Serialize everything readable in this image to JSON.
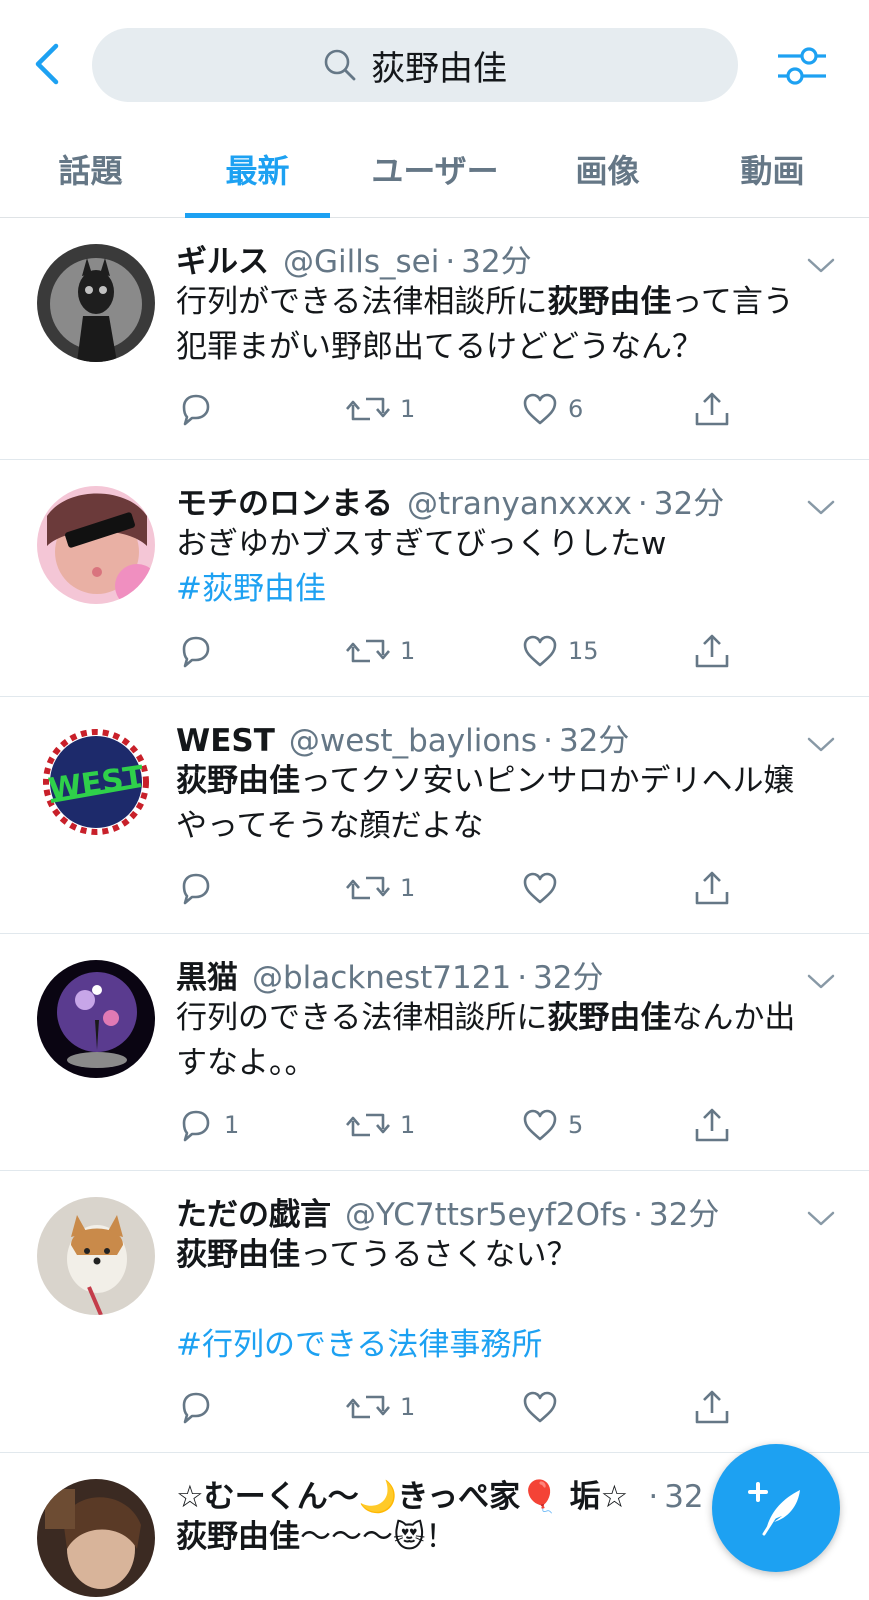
{
  "header": {
    "search_value": "荻野由佳"
  },
  "tabs": [
    {
      "label": "話題"
    },
    {
      "label": "最新"
    },
    {
      "label": "ユーザー"
    },
    {
      "label": "画像"
    },
    {
      "label": "動画"
    }
  ],
  "active_tab": "最新",
  "accent_color": "#1da1f2",
  "tweets": [
    {
      "name": "ギルス",
      "handle": "@Gills_sei",
      "time": "32分",
      "text_before": "行列ができる法律相談所に",
      "text_bold": "荻野由佳",
      "text_after": "って言う犯罪まがい野郎出てるけどどうなん？",
      "reply_count": "",
      "retweet_count": "1",
      "like_count": "6"
    },
    {
      "name": "モチのロンまる",
      "handle": "@tranyanxxxx",
      "time": "32分",
      "text": "おぎゆかブスすぎてびっくりしたw",
      "hashtag": "#荻野由佳",
      "reply_count": "",
      "retweet_count": "1",
      "like_count": "15"
    },
    {
      "name": "WEST",
      "handle": "@west_baylions",
      "time": "32分",
      "text_bold": "荻野由佳",
      "text_after": "ってクソ安いピンサロかデリヘル嬢やってそうな顔だよな",
      "reply_count": "",
      "retweet_count": "1",
      "like_count": ""
    },
    {
      "name": "黒猫",
      "handle": "@blacknest7121",
      "time": "32分",
      "text_before": "行列のできる法律相談所に",
      "text_bold": "荻野由佳",
      "text_after": "なんか出すなよ。。",
      "reply_count": "1",
      "retweet_count": "1",
      "like_count": "5"
    },
    {
      "name": "ただの戯言",
      "handle": "@YC7ttsr5eyf2Ofs",
      "time": "32分",
      "text_bold": "荻野由佳",
      "text_after": "ってうるさくない？",
      "hashtag": "#行列のできる法律事務所",
      "reply_count": "",
      "retweet_count": "1",
      "like_count": ""
    },
    {
      "name": "☆むーくん〜🌙きっぺ家🎈 垢☆",
      "time": "32",
      "text_bold": "荻野由佳",
      "text_after": "〜〜〜😻！"
    }
  ],
  "icons": {
    "back": "chevron-left-icon",
    "search": "search-icon",
    "filter": "sliders-icon",
    "reply": "reply-icon",
    "retweet": "retweet-icon",
    "like": "heart-icon",
    "share": "share-icon",
    "compose": "compose-feather-icon"
  }
}
